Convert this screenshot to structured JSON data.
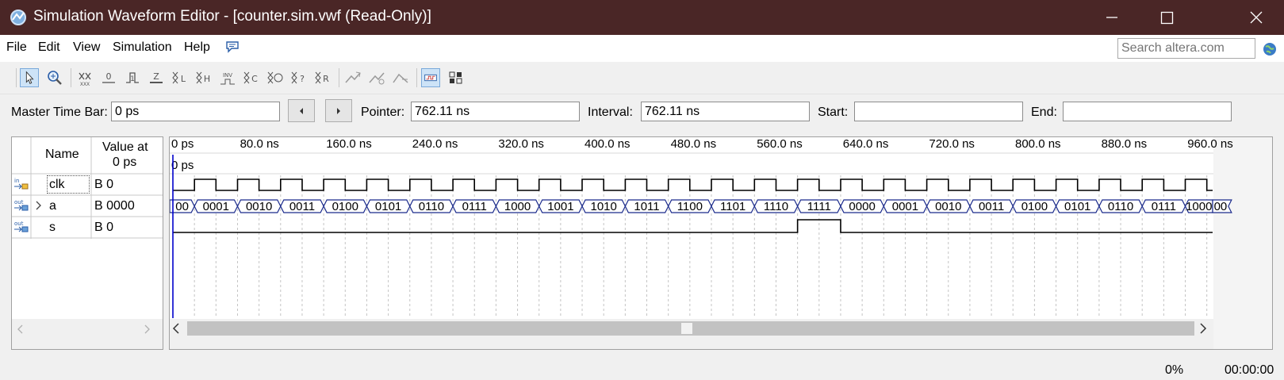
{
  "window": {
    "title": "Simulation Waveform Editor - [counter.sim.vwf (Read-Only)]"
  },
  "menu": [
    "File",
    "Edit",
    "View",
    "Simulation",
    "Help"
  ],
  "search": {
    "placeholder": "Search altera.com"
  },
  "timebar": {
    "master_label": "Master Time Bar:",
    "master_value": "0 ps",
    "pointer_label": "Pointer:",
    "pointer_value": "762.11 ns",
    "interval_label": "Interval:",
    "interval_value": "762.11 ns",
    "start_label": "Start:",
    "start_value": "",
    "end_label": "End:",
    "end_value": ""
  },
  "table": {
    "name_header": "Name",
    "value_header_line1": "Value at",
    "value_header_line2": "0 ps"
  },
  "signals": [
    {
      "type_icon": "input-pin-icon",
      "name": "clk",
      "value": "B 0",
      "expandable": false
    },
    {
      "type_icon": "output-pin-icon",
      "name": "a",
      "value": "B 0000",
      "expandable": true
    },
    {
      "type_icon": "output-pin-icon",
      "name": "s",
      "value": "B 0",
      "expandable": false
    }
  ],
  "timeline": {
    "ticks": [
      "0 ps",
      "80.0 ns",
      "160.0 ns",
      "240.0 ns",
      "320.0 ns",
      "400.0 ns",
      "480.0 ns",
      "560.0 ns",
      "640.0 ns",
      "720.0 ns",
      "800.0 ns",
      "880.0 ns",
      "960.0 ns"
    ],
    "cursor_label": "0 ps"
  },
  "bus_values": [
    "00",
    "0001",
    "0010",
    "0011",
    "0100",
    "0101",
    "0110",
    "0111",
    "1000",
    "1001",
    "1010",
    "1011",
    "1100",
    "1101",
    "1110",
    "1111",
    "0000",
    "0001",
    "0010",
    "0011",
    "0100",
    "0101",
    "0110",
    "0111",
    "1000",
    "00"
  ],
  "s_high_segment_index": 15,
  "status": {
    "progress": "0%",
    "time": "00:00:00"
  },
  "colors": {
    "title_bg": "#4a2626",
    "bus_stroke": "#1a2a8c",
    "cursor": "#0000cc"
  }
}
